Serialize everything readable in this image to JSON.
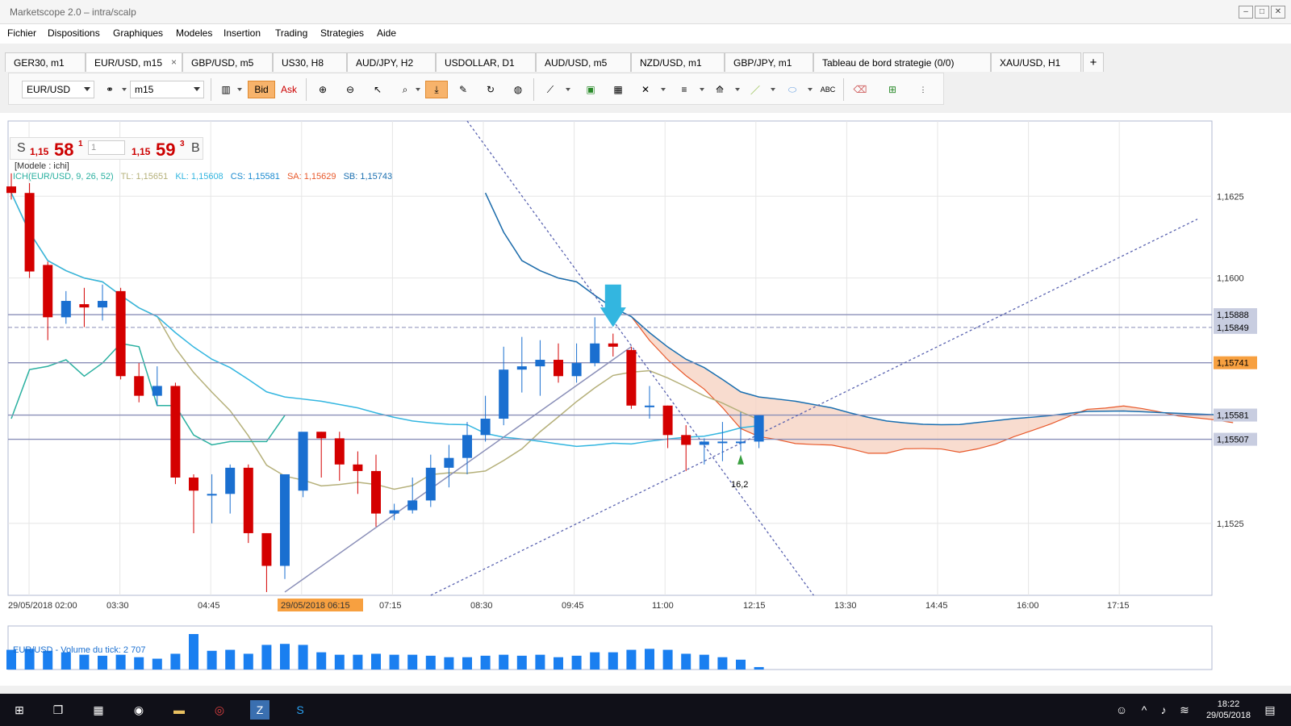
{
  "window": {
    "title": "Marketscope 2.0 – intra/scalp"
  },
  "menu": [
    "Fichier",
    "Dispositions",
    "Graphiques",
    "Modeles",
    "Insertion",
    "Trading",
    "Strategies",
    "Aide"
  ],
  "tabs": [
    {
      "label": "GER30, m1",
      "active": false
    },
    {
      "label": "EUR/USD, m15",
      "active": true,
      "close": "×"
    },
    {
      "label": "GBP/USD, m5",
      "active": false
    },
    {
      "label": "US30, H8",
      "active": false
    },
    {
      "label": "AUD/JPY, H2",
      "active": false
    },
    {
      "label": "USDOLLAR, D1",
      "active": false
    },
    {
      "label": "AUD/USD, m5",
      "active": false
    },
    {
      "label": "NZD/USD, m1",
      "active": false
    },
    {
      "label": "GBP/JPY, m1",
      "active": false
    },
    {
      "label": "Tableau de bord strategie (0/0)",
      "active": false
    },
    {
      "label": "XAU/USD, H1",
      "active": false
    }
  ],
  "new_tab": "+",
  "toolbar": {
    "symbol": "EUR/USD",
    "timeframe": "m15",
    "bid": "Bid",
    "ask": "Ask"
  },
  "quote": {
    "sell_side": "S",
    "sell_prefix": "1,15",
    "sell_big": "58",
    "sell_sup": "1",
    "qty": "1",
    "buy_prefix": "1,15",
    "buy_big": "59",
    "buy_sup": "3",
    "buy_side": "B"
  },
  "model_label": "[Modele : ichi]",
  "ichi_legend": {
    "name": "ICH(EUR/USD, 9, 26, 52)",
    "tl": "TL: 1,15651",
    "kl": "KL: 1,15608",
    "cs": "CS: 1,15581",
    "sa": "SA: 1,15629",
    "sb": "SB: 1,15743"
  },
  "colors": {
    "up": "#1a6fd0",
    "down": "#d40000",
    "tenkan": "#b5b07a",
    "kijun": "#33b6e0",
    "senkou_a": "#e8582a",
    "senkou_b": "#1a6fb0",
    "chikou": "#2ab0a0",
    "cloud": "#f6d3c3",
    "line": "#8a8fb8",
    "volume": "#1a7ff0"
  },
  "chart_data": {
    "type": "candlestick",
    "symbol": "EUR/USD",
    "timeframe": "m15",
    "ylim": [
      1.1503,
      1.1648
    ],
    "y_ticks": [
      "1,1625",
      "1,1600",
      "1,1525"
    ],
    "y_tick_values": [
      1.1625,
      1.16,
      1.1525
    ],
    "x_ticks": [
      "29/05/2018 02:00",
      "03:30",
      "04:45",
      "29/05/2018 06:15",
      "07:15",
      "08:30",
      "09:45",
      "11:00",
      "12:15",
      "13:30",
      "14:45",
      "16:00",
      "17:15"
    ],
    "price_tags": [
      {
        "label": "1,15888",
        "value": 1.15888,
        "highlight": false
      },
      {
        "label": "1,15849",
        "value": 1.15849,
        "highlight": false
      },
      {
        "label": "1,15741",
        "value": 1.15741,
        "highlight": true
      },
      {
        "label": "1,15581",
        "value": 1.15581,
        "highlight": false
      },
      {
        "label": "1,15507",
        "value": 1.15507,
        "highlight": false
      }
    ],
    "annotation": "16,2",
    "candles": [
      [
        1.1628,
        1.1632,
        1.1624,
        1.1626
      ],
      [
        1.1626,
        1.1629,
        1.16,
        1.1602
      ],
      [
        1.1604,
        1.1605,
        1.1581,
        1.1588
      ],
      [
        1.1588,
        1.1596,
        1.1586,
        1.1593
      ],
      [
        1.1592,
        1.1597,
        1.1585,
        1.1591
      ],
      [
        1.1591,
        1.1598,
        1.1587,
        1.1593
      ],
      [
        1.1596,
        1.1597,
        1.1569,
        1.157
      ],
      [
        1.157,
        1.1574,
        1.1562,
        1.1564
      ],
      [
        1.1564,
        1.1573,
        1.1561,
        1.1567
      ],
      [
        1.1567,
        1.1568,
        1.1537,
        1.1539
      ],
      [
        1.1539,
        1.154,
        1.1522,
        1.1535
      ],
      [
        1.1534,
        1.154,
        1.1525,
        1.1534
      ],
      [
        1.1534,
        1.1543,
        1.1528,
        1.1542
      ],
      [
        1.1542,
        1.1543,
        1.1519,
        1.1522
      ],
      [
        1.1522,
        1.1522,
        1.1504,
        1.1512
      ],
      [
        1.1512,
        1.1536,
        1.1508,
        1.154
      ],
      [
        1.1535,
        1.1551,
        1.1533,
        1.1553
      ],
      [
        1.1553,
        1.1553,
        1.1539,
        1.1551
      ],
      [
        1.1551,
        1.1553,
        1.1538,
        1.1543
      ],
      [
        1.1543,
        1.1547,
        1.1534,
        1.1541
      ],
      [
        1.1541,
        1.1546,
        1.1524,
        1.1528
      ],
      [
        1.1528,
        1.1531,
        1.1526,
        1.1529
      ],
      [
        1.1529,
        1.1539,
        1.1528,
        1.1532
      ],
      [
        1.1532,
        1.1546,
        1.153,
        1.1542
      ],
      [
        1.1542,
        1.1549,
        1.1536,
        1.1545
      ],
      [
        1.1545,
        1.1556,
        1.154,
        1.1552
      ],
      [
        1.1552,
        1.1564,
        1.155,
        1.1557
      ],
      [
        1.1557,
        1.1579,
        1.1555,
        1.1572
      ],
      [
        1.1572,
        1.1582,
        1.1565,
        1.1573
      ],
      [
        1.1573,
        1.1581,
        1.1564,
        1.1575
      ],
      [
        1.1575,
        1.158,
        1.1568,
        1.157
      ],
      [
        1.157,
        1.158,
        1.1568,
        1.1574
      ],
      [
        1.1574,
        1.1588,
        1.1573,
        1.158
      ],
      [
        1.158,
        1.1583,
        1.1576,
        1.1579
      ],
      [
        1.1578,
        1.1579,
        1.156,
        1.1561
      ],
      [
        1.1561,
        1.1567,
        1.1557,
        1.1561
      ],
      [
        1.1561,
        1.1561,
        1.1548,
        1.1552
      ],
      [
        1.1552,
        1.1555,
        1.1541,
        1.1549
      ],
      [
        1.1549,
        1.1551,
        1.1543,
        1.155
      ],
      [
        1.155,
        1.1556,
        1.1544,
        1.155
      ],
      [
        1.155,
        1.1559,
        1.1547,
        1.155
      ],
      [
        1.155,
        1.1558,
        1.1548,
        1.1558
      ]
    ],
    "volume": [
      40,
      42,
      38,
      35,
      30,
      28,
      30,
      25,
      22,
      32,
      72,
      38,
      40,
      32,
      50,
      52,
      50,
      35,
      30,
      30,
      32,
      30,
      30,
      28,
      25,
      25,
      28,
      30,
      28,
      30,
      25,
      28,
      35,
      35,
      40,
      42,
      40,
      32,
      30,
      25,
      20,
      5
    ],
    "volume_label": "EUR/USD - Volume du tick: 2 707"
  },
  "taskbar": {
    "time": "18:22",
    "date": "29/05/2018"
  }
}
